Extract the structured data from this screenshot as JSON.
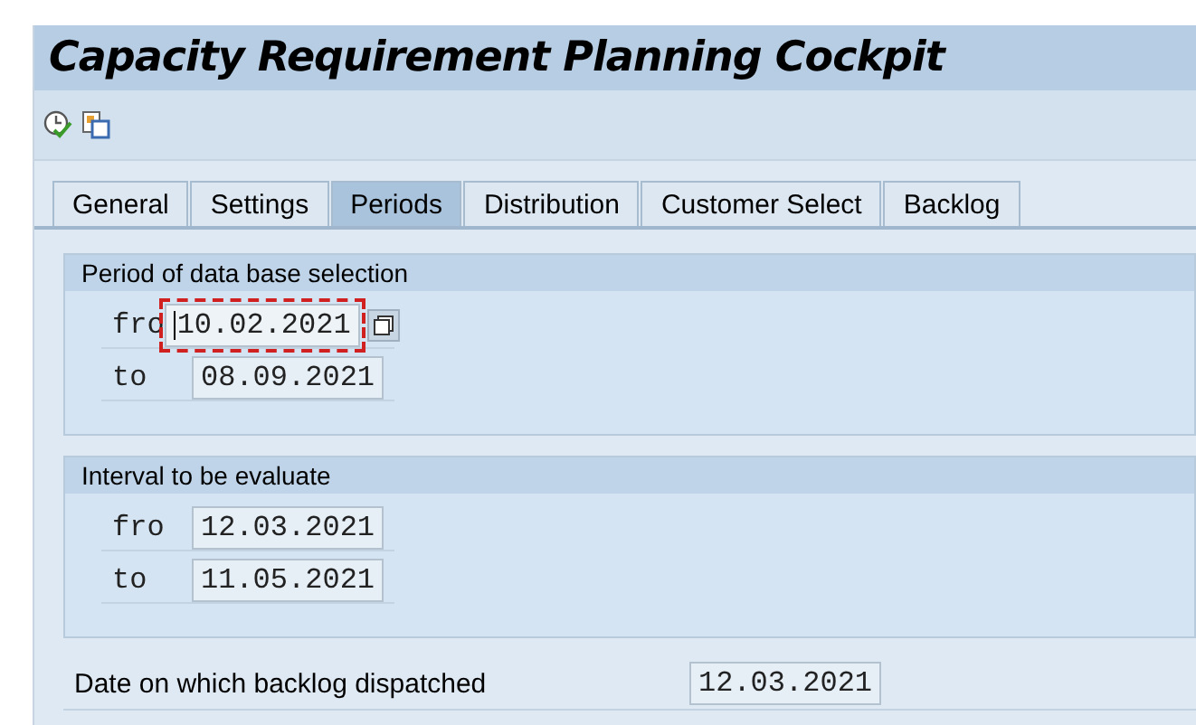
{
  "window": {
    "title": "Capacity Requirement Planning Cockpit"
  },
  "tabs": [
    {
      "label": "General",
      "selected": false
    },
    {
      "label": "Settings",
      "selected": false
    },
    {
      "label": "Periods",
      "selected": true
    },
    {
      "label": "Distribution",
      "selected": false
    },
    {
      "label": "Customer Select",
      "selected": false
    },
    {
      "label": "Backlog",
      "selected": false
    }
  ],
  "groups": [
    {
      "title": "Period of data base selection",
      "fields": [
        {
          "label": "fro",
          "value": "10.02.2021",
          "focused": true
        },
        {
          "label": "to",
          "value": "08.09.2021",
          "focused": false
        }
      ]
    },
    {
      "title": "Interval to be evaluate",
      "fields": [
        {
          "label": "fro",
          "value": "12.03.2021",
          "focused": false
        },
        {
          "label": "to",
          "value": "11.05.2021",
          "focused": false
        }
      ]
    }
  ],
  "backlog_date": {
    "label": "Date on which backlog dispatched",
    "value": "12.03.2021"
  }
}
